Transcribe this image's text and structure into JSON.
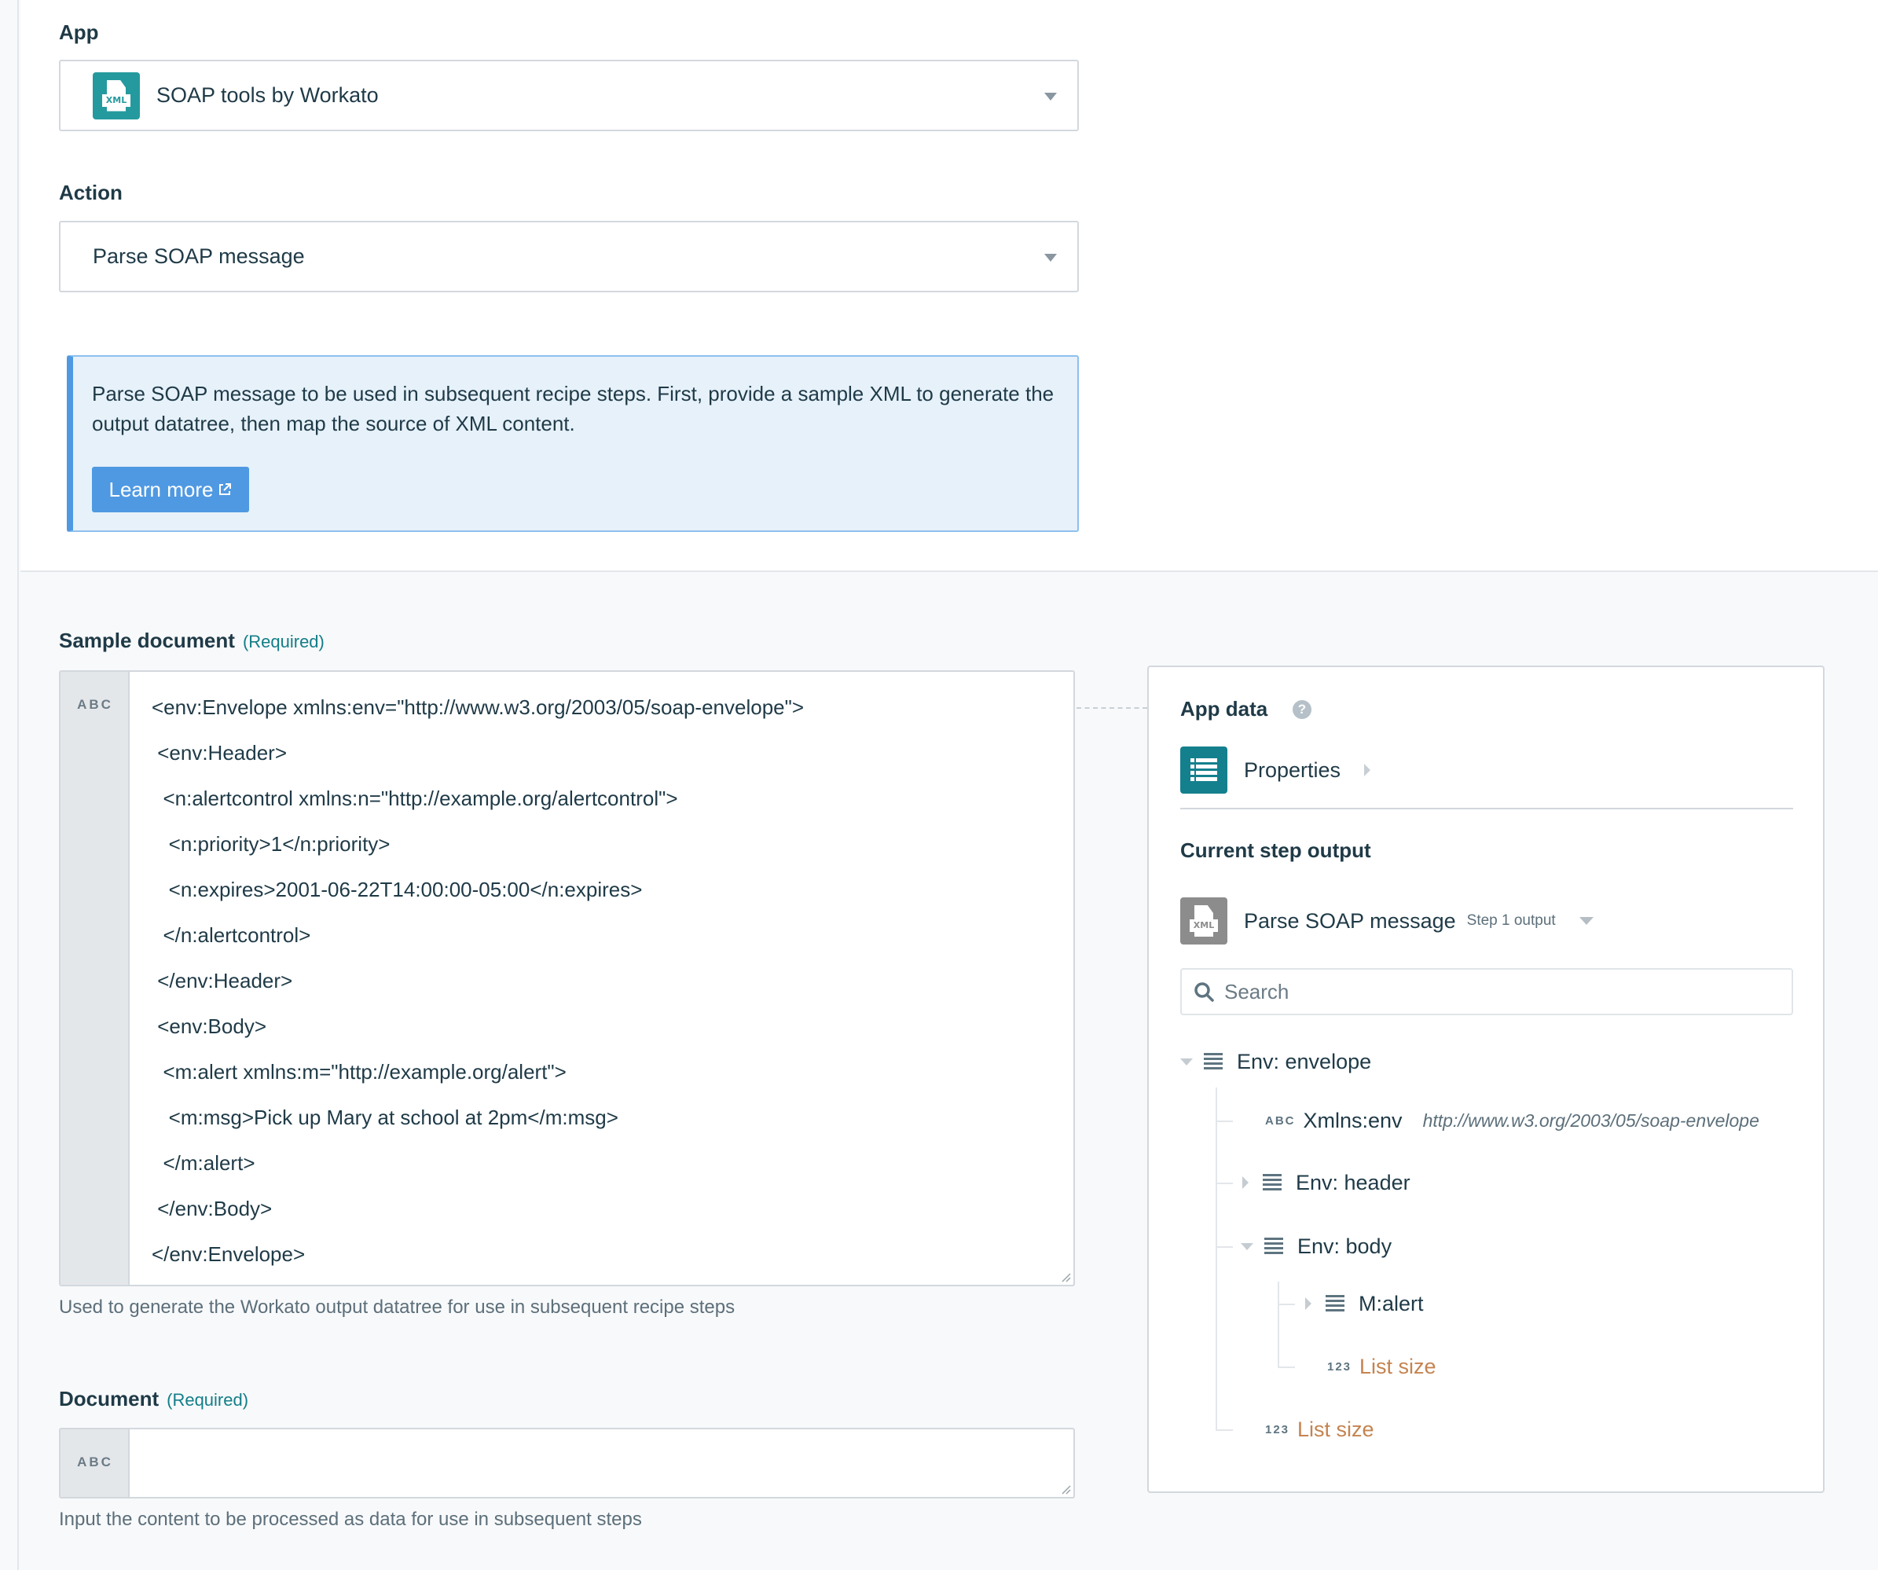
{
  "app_field": {
    "label": "App",
    "value": "SOAP tools by Workato",
    "icon": "xml-file-icon",
    "icon_color": "#249a9e"
  },
  "action_field": {
    "label": "Action",
    "value": "Parse SOAP message"
  },
  "info_box": {
    "text": "Parse SOAP message to be used in subsequent recipe steps. First, provide a sample XML to generate the output datatree, then map the source of XML content.",
    "button_label": "Learn more",
    "button_icon": "external-link-icon",
    "accent_color": "#4f99e2"
  },
  "sample_document": {
    "label": "Sample document",
    "required_label": "(Required)",
    "type_badge": "ABC",
    "lines": [
      "<env:Envelope xmlns:env=\"http://www.w3.org/2003/05/soap-envelope\">",
      " <env:Header>",
      "  <n:alertcontrol xmlns:n=\"http://example.org/alertcontrol\">",
      "   <n:priority>1</n:priority>",
      "   <n:expires>2001-06-22T14:00:00-05:00</n:expires>",
      "  </n:alertcontrol>",
      " </env:Header>",
      " <env:Body>",
      "  <m:alert xmlns:m=\"http://example.org/alert\">",
      "   <m:msg>Pick up Mary at school at 2pm</m:msg>",
      "  </m:alert>",
      " </env:Body>",
      "</env:Envelope>"
    ],
    "helper": "Used to generate the Workato output datatree for use in subsequent recipe steps"
  },
  "document": {
    "label": "Document",
    "required_label": "(Required)",
    "type_badge": "ABC",
    "value": "",
    "helper": "Input the content to be processed as data for use in subsequent steps"
  },
  "app_data_panel": {
    "title": "App data",
    "help_icon": "?",
    "properties_label": "Properties",
    "current_step_title": "Current step output",
    "step_name": "Parse SOAP message",
    "step_sub": "Step 1 output",
    "search_placeholder": "Search",
    "tree": {
      "root": {
        "label": "Env: envelope",
        "expanded": true
      },
      "xmlns": {
        "badge": "ABC",
        "label": "Xmlns:env",
        "value": "http://www.w3.org/2003/05/soap-envelope"
      },
      "header": {
        "label": "Env: header",
        "expanded": false
      },
      "body": {
        "label": "Env: body",
        "expanded": true
      },
      "alert": {
        "label": "M:alert",
        "expanded": false
      },
      "body_list_size": {
        "badge": "123",
        "label": "List size"
      },
      "root_list_size": {
        "badge": "123",
        "label": "List size"
      }
    },
    "list_size_color": "#c5834f"
  }
}
